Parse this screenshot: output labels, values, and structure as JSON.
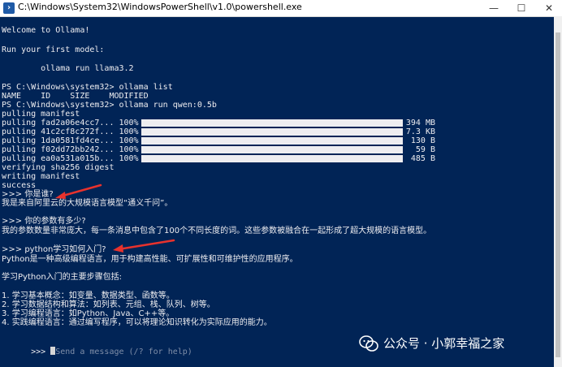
{
  "window": {
    "title": "C:\\Windows\\System32\\WindowsPowerShell\\v1.0\\powershell.exe",
    "minimize_label": "—",
    "maximize_label": "☐",
    "close_label": "✕"
  },
  "terminal": {
    "welcome": "Welcome to Ollama!",
    "run_first": "Run your first model:",
    "run_cmd": "        ollama run llama3.2",
    "prompt1": "PS C:\\Windows\\system32> ollama list",
    "list_header": "NAME    ID    SIZE    MODIFIED",
    "prompt2": "PS C:\\Windows\\system32> ollama run qwen:0.5b",
    "pulling_manifest": "pulling manifest",
    "pulls": [
      {
        "label": "pulling fad2a06e4cc7... 100%",
        "size": "394 MB",
        "progress": 1.0
      },
      {
        "label": "pulling 41c2cf8c272f... 100%",
        "size": "7.3 KB",
        "progress": 1.0
      },
      {
        "label": "pulling 1da0581fd4ce... 100%",
        "size": "130 B",
        "progress": 1.0
      },
      {
        "label": "pulling f02dd72bb242... 100%",
        "size": "59 B",
        "progress": 1.0
      },
      {
        "label": "pulling ea0a531a015b... 100%",
        "size": "485 B",
        "progress": 1.0
      }
    ],
    "verifying": "verifying sha256 digest",
    "writing": "writing manifest",
    "success": "success",
    "q1": ">>> 你是谁?",
    "a1": "我是来自阿里云的大规模语言模型“通义千问”。",
    "q2": ">>> 你的参数有多少?",
    "a2": "我的参数数量非常庞大，每一条消息中包含了100个不同长度的词。这些参数被融合在一起形成了超大规模的语言模型。",
    "q3": ">>> python学习如何入门?",
    "a3_1": "Python是一种高级编程语言，用于构建高性能、可扩展性和可维护性的应用程序。",
    "a3_2": "学习Python入门的主要步骤包括:",
    "steps": [
      "1. 学习基本概念：如变量、数据类型、函数等。",
      "2. 学习数据结构和算法：如列表、元组、栈、队列、树等。",
      "3. 学习编程语言：如Python、Java、C++等。",
      "4. 实践编程语言：通过编写程序，可以将理论知识转化为实际应用的能力。"
    ],
    "input_prompt": ">>> ",
    "input_placeholder": "Send a message (/? for help)"
  },
  "watermark": {
    "text": "公众号 · 小郭幸福之家"
  },
  "colors": {
    "terminal_bg": "#012456",
    "terminal_fg": "#eeedf0",
    "arrow": "#e8322d"
  }
}
